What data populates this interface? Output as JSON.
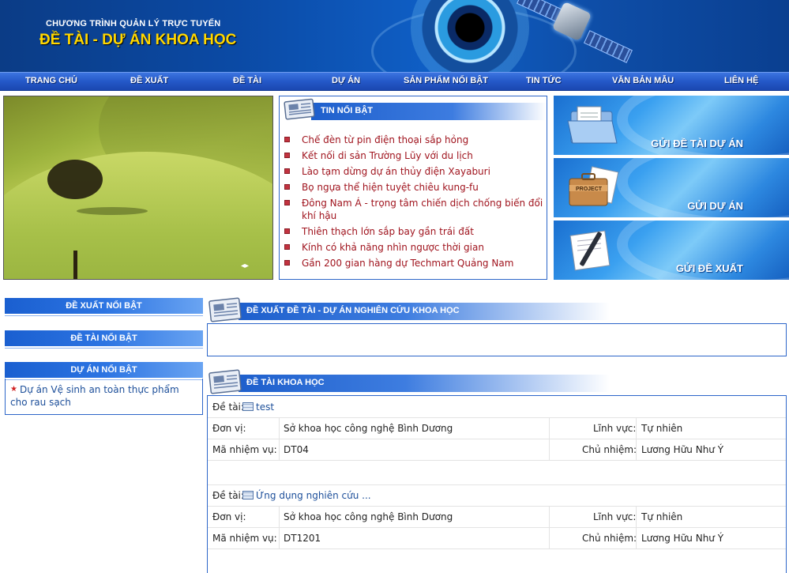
{
  "header": {
    "subtitle": "CHƯƠNG TRÌNH QUẢN LÝ TRỰC TUYẾN",
    "title": "ĐỀ TÀI - DỰ ÁN KHOA HỌC"
  },
  "nav": {
    "items": [
      "TRANG CHỦ",
      "ĐỀ XUẤT",
      "ĐỀ TÀI",
      "DỰ ÁN",
      "SẢN PHẨM NỔI BẬT",
      "TIN TỨC",
      "VĂN BẢN MẪU",
      "LIÊN HỆ"
    ]
  },
  "news": {
    "heading": "TIN NỔI BẬT",
    "items": [
      "Chế đèn từ pin điện thoại sắp hỏng",
      "Kết nối di sản Trường Lũy với du lịch",
      "Lào tạm dừng dự án thủy điện Xayaburi",
      "Bọ ngựa thể hiện tuyệt chiêu kung-fu",
      "Đông Nam Á - trọng tâm chiến dịch chống biến đổi khí hậu",
      "Thiên thạch lớn sắp bay gần trái đất",
      "Kính có khả năng nhìn ngược thời gian",
      "Gần 200 gian hàng dự Techmart Quảng Nam"
    ]
  },
  "banners": {
    "submit_topic_project": "GỬI ĐỀ TÀI DỰ ÁN",
    "project_tag": "PROJECT",
    "submit_project": "GỬI DỰ ÁN",
    "submit_proposal": "GỬI ĐỀ XUẤT"
  },
  "sidebar": {
    "featured_proposals": "ĐỀ XUẤT NỔI BẬT",
    "featured_topics": "ĐỀ TÀI NỔI BẬT",
    "featured_projects": "DỰ ÁN NỔI BẬT",
    "project_link": "Dự án Vệ sinh an toàn thực phẩm cho rau sạch"
  },
  "sections": {
    "proposals_heading": "ĐỀ XUẤT ĐỀ TÀI - DỰ ÁN NGHIÊN CỨU KHOA HỌC",
    "topics_heading": "ĐỀ TÀI KHOA HỌC"
  },
  "topic_labels": {
    "topic": "Đề tài:",
    "unit": "Đơn vị:",
    "field": "Lĩnh vực:",
    "code": "Mã nhiệm vụ:",
    "leader": "Chủ nhiệm:"
  },
  "topics": [
    {
      "name": "test",
      "unit": "Sở khoa học công nghệ Bình Dương",
      "field": "Tự nhiên",
      "code": "DT04",
      "leader": "Lương Hữu Như Ý"
    },
    {
      "name": "Ứng dụng nghiên cứu ...",
      "unit": "Sở khoa học công nghệ Bình Dương",
      "field": "Tự nhiên",
      "code": "DT1201",
      "leader": "Lương Hữu Như Ý"
    }
  ]
}
